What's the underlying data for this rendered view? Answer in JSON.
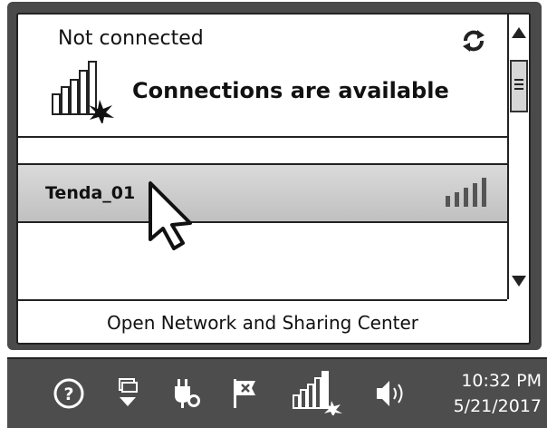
{
  "flyout": {
    "status_title": "Not connected",
    "connections_text": "Connections are available",
    "networks": [
      {
        "name": "Tenda_01",
        "signal_bars": 5
      }
    ],
    "footer_link": "Open Network and Sharing Center"
  },
  "taskbar": {
    "tray_icons": [
      "help-icon",
      "action-center-icon",
      "power-plug-icon",
      "flag-icon",
      "network-icon",
      "volume-icon"
    ],
    "time": "10:32 PM",
    "date": "5/21/2017"
  },
  "colors": {
    "taskbar_bg": "#4d4d4d",
    "flyout_border": "#4a4a4a",
    "selected_item": "#c8c8c8"
  }
}
